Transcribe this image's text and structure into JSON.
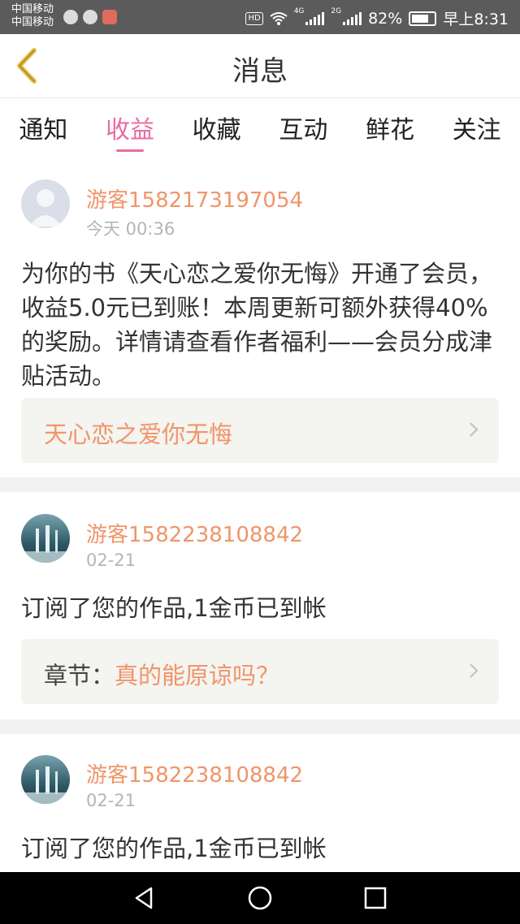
{
  "status_bar": {
    "carrier1": "中国移动",
    "carrier2": "中国移动",
    "hd": "HD",
    "sig1_label": "4G",
    "sig2_label": "2G",
    "battery": "82%",
    "time": "早上8:31"
  },
  "header": {
    "title": "消息"
  },
  "tabs": [
    {
      "label": "通知"
    },
    {
      "label": "收益"
    },
    {
      "label": "收藏"
    },
    {
      "label": "互动"
    },
    {
      "label": "鲜花"
    },
    {
      "label": "关注"
    }
  ],
  "active_tab": "收益",
  "messages": [
    {
      "user": "游客1582173197054",
      "time": "今天 00:36",
      "text": "为你的书《天心恋之爱你无悔》开通了会员，收益5.0元已到账！本周更新可额外获得40%的奖励。详情请查看作者福利——会员分成津贴活动。",
      "link_prefix": "",
      "link_text": "天心恋之爱你无悔"
    },
    {
      "user": "游客1582238108842",
      "time": "02-21",
      "text": "订阅了您的作品,1金币已到帐",
      "link_prefix": "章节：",
      "link_text": "真的能原谅吗？"
    },
    {
      "user": "游客1582238108842",
      "time": "02-21",
      "text": "订阅了您的作品,1金币已到帐"
    }
  ],
  "colors": {
    "accent": "#e86ca3",
    "username": "#f0956a",
    "status_bar": "#5b5b5b"
  }
}
